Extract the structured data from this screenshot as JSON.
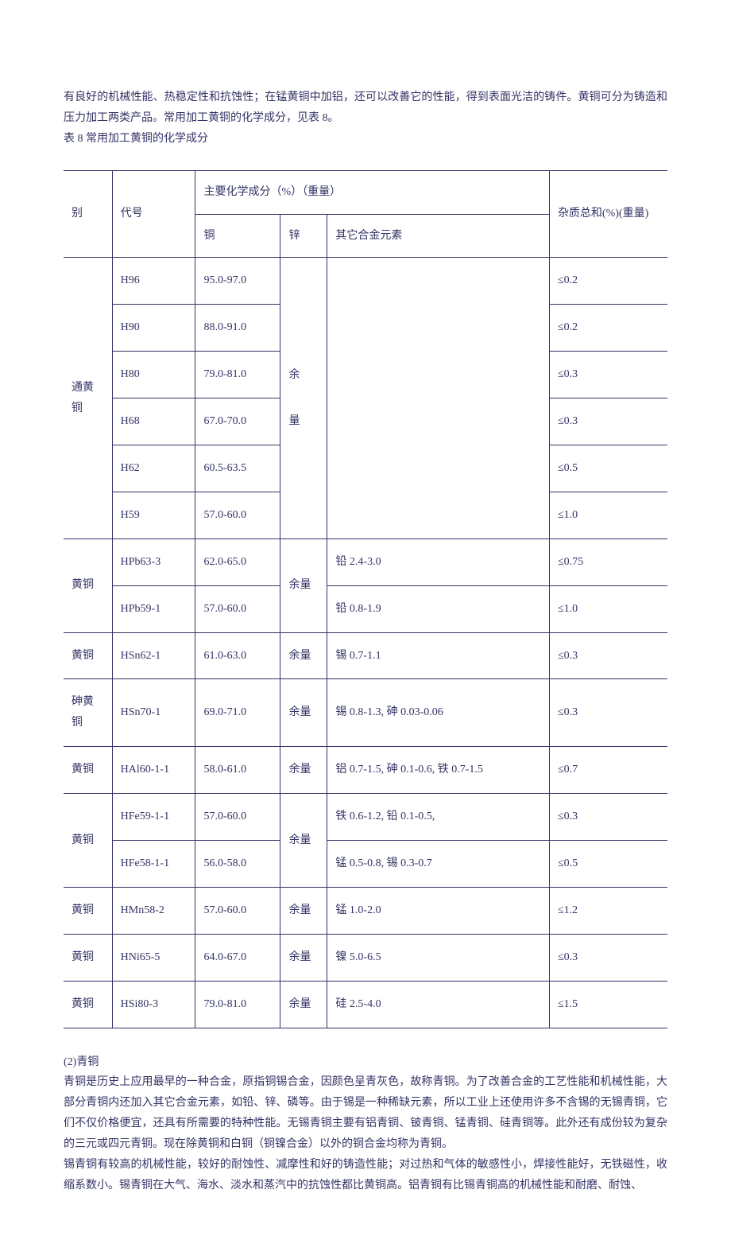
{
  "intro": {
    "p1": "有良好的机械性能、热稳定性和抗蚀性；在锰黄铜中加铝，还可以改善它的性能，得到表面光洁的铸件。黄铜可分为铸造和压力加工两类产品。常用加工黄铜的化学成分，见表 8。",
    "caption": "表 8 常用加工黄铜的化学成分"
  },
  "headers": {
    "col1": "别",
    "col2": "代号",
    "main_group": "主要化学成分（%）（重量）",
    "copper": "铜",
    "zinc": "锌",
    "other": "其它合金元素",
    "impurity": "杂质总和(%)(重量)"
  },
  "groups": [
    {
      "name": "通黄铜",
      "zinc": [
        "余",
        "量"
      ],
      "rows": [
        {
          "code": "H96",
          "cu": "95.0-97.0",
          "other": "",
          "imp": "≤0.2"
        },
        {
          "code": "H90",
          "cu": "88.0-91.0",
          "other": "",
          "imp": "≤0.2"
        },
        {
          "code": "H80",
          "cu": "79.0-81.0",
          "other": "",
          "imp": "≤0.3"
        },
        {
          "code": "H68",
          "cu": "67.0-70.0",
          "other": "",
          "imp": "≤0.3"
        },
        {
          "code": "H62",
          "cu": "60.5-63.5",
          "other": "",
          "imp": "≤0.5"
        },
        {
          "code": "H59",
          "cu": "57.0-60.0",
          "other": "",
          "imp": "≤1.0"
        }
      ]
    },
    {
      "name": "黄铜",
      "zinc_span": "余量",
      "rows": [
        {
          "code": "HPb63-3",
          "cu": "62.0-65.0",
          "other": "铅 2.4-3.0",
          "imp": "≤0.75"
        },
        {
          "code": "HPb59-1",
          "cu": "57.0-60.0",
          "other": "铅 0.8-1.9",
          "imp": "≤1.0"
        }
      ]
    },
    {
      "name": "黄铜",
      "rows": [
        {
          "code": "HSn62-1",
          "cu": "61.0-63.0",
          "zinc": "余量",
          "other": "锡 0.7-1.1",
          "imp": "≤0.3"
        }
      ]
    },
    {
      "name": "砷黄铜",
      "rows": [
        {
          "code": "HSn70-1",
          "cu": "69.0-71.0",
          "zinc": "余量",
          "other": "锡 0.8-1.3, 砷 0.03-0.06",
          "imp": "≤0.3"
        }
      ]
    },
    {
      "name": "黄铜",
      "rows": [
        {
          "code": "HAl60-1-1",
          "cu": "58.0-61.0",
          "zinc": "余量",
          "other": "铝 0.7-1.5, 砷 0.1-0.6, 铁 0.7-1.5",
          "imp": "≤0.7"
        }
      ]
    },
    {
      "name": "黄铜",
      "zinc_span": "余量",
      "rows": [
        {
          "code": "HFe59-1-1",
          "cu": "57.0-60.0",
          "other": "铁 0.6-1.2, 铅 0.1-0.5,",
          "imp": "≤0.3"
        },
        {
          "code": "HFe58-1-1",
          "cu": "56.0-58.0",
          "other": "锰 0.5-0.8, 锡 0.3-0.7",
          "imp": "≤0.5"
        }
      ]
    },
    {
      "name": "黄铜",
      "rows": [
        {
          "code": "HMn58-2",
          "cu": "57.0-60.0",
          "zinc": "余量",
          "other": "锰 1.0-2.0",
          "imp": "≤1.2"
        }
      ]
    },
    {
      "name": "黄铜",
      "rows": [
        {
          "code": "HNi65-5",
          "cu": "64.0-67.0",
          "zinc": "余量",
          "other": "镍 5.0-6.5",
          "imp": "≤0.3"
        }
      ]
    },
    {
      "name": "黄铜",
      "rows": [
        {
          "code": "HSi80-3",
          "cu": "79.0-81.0",
          "zinc": "余量",
          "other": "硅 2.5-4.0",
          "imp": "≤1.5"
        }
      ]
    }
  ],
  "outro": {
    "h": "(2)青铜",
    "p1": "青铜是历史上应用最早的一种合金，原指铜锡合金，因颜色呈青灰色，故称青铜。为了改善合金的工艺性能和机械性能，大部分青铜内还加入其它合金元素，如铅、锌、磷等。由于锡是一种稀缺元素，所以工业上还使用许多不含锡的无锡青铜，它们不仅价格便宜，还具有所需要的特种性能。无锡青铜主要有铝青铜、铍青铜、锰青铜、硅青铜等。此外还有成份较为复杂的三元或四元青铜。现在除黄铜和白铜（铜镍合金）以外的铜合金均称为青铜。",
    "p2": "锡青铜有较高的机械性能，较好的耐蚀性、减摩性和好的铸造性能；对过热和气体的敏感性小，焊接性能好，无铁磁性，收缩系数小。锡青铜在大气、海水、淡水和蒸汽中的抗蚀性都比黄铜高。铝青铜有比锡青铜高的机械性能和耐磨、耐蚀、"
  }
}
